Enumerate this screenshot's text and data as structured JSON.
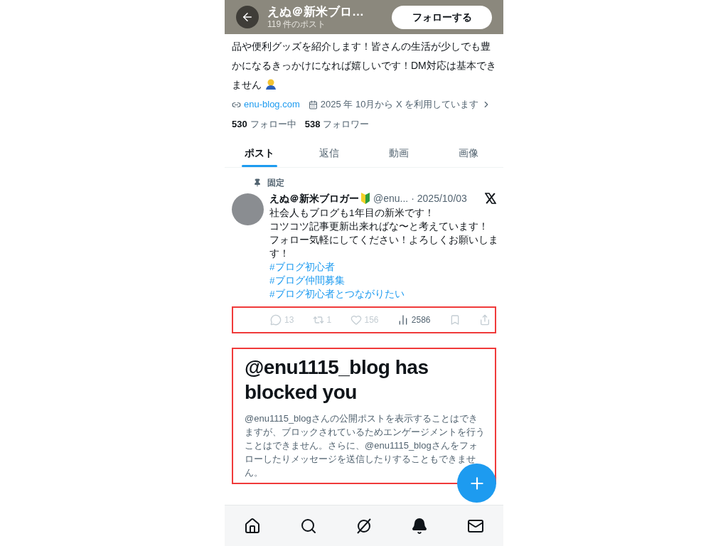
{
  "header": {
    "name": "えぬ＠新米ブロ…",
    "post_count": "119 件のポスト",
    "follow_button": "フォローする"
  },
  "bio": {
    "text": "品や便利グッズを紹介します！皆さんの生活が少しでも豊かになるきっかけになれば嬉しいです！DM対応は基本できません",
    "link": "enu-blog.com",
    "joined": "2025 年 10月から X を利用しています"
  },
  "stats": [
    {
      "count": "530",
      "label": "フォロー中"
    },
    {
      "count": "538",
      "label": "フォロワー"
    }
  ],
  "tabs": [
    {
      "label": "ポスト",
      "selected": true
    },
    {
      "label": "返信",
      "selected": false
    },
    {
      "label": "動画",
      "selected": false
    },
    {
      "label": "画像",
      "selected": false
    }
  ],
  "pinned_post": {
    "pinned_label": "固定",
    "author": "えぬ＠新米ブロガー",
    "handle": "@enu...",
    "date": "· 2025/10/03",
    "lines": [
      "社会人もブログも1年目の新米です！",
      "コツコツ記事更新出来ればな〜と考えています！",
      "フォロー気軽にしてください！よろしくお願いします！"
    ],
    "hashtags": [
      "#ブログ初心者",
      "#ブログ仲間募集",
      "#ブログ初心者とつながりたい"
    ],
    "actions": [
      {
        "kind": "reply",
        "count": "13",
        "disabled": true
      },
      {
        "kind": "repost",
        "count": "1",
        "disabled": true
      },
      {
        "kind": "like",
        "count": "156",
        "disabled": true
      },
      {
        "kind": "views",
        "count": "2586",
        "disabled": false
      },
      {
        "kind": "bookmark",
        "disabled": true
      },
      {
        "kind": "share",
        "disabled": true
      }
    ]
  },
  "blocked_notice": {
    "title": "@enu1115_blog has blocked you",
    "body": "@enu1115_blogさんの公開ポストを表示することはできますが、ブロックされているためエンゲージメントを行うことはできません。さらに、@enu1115_blogさんをフォローしたりメッセージを送信したりすることもできません。"
  }
}
